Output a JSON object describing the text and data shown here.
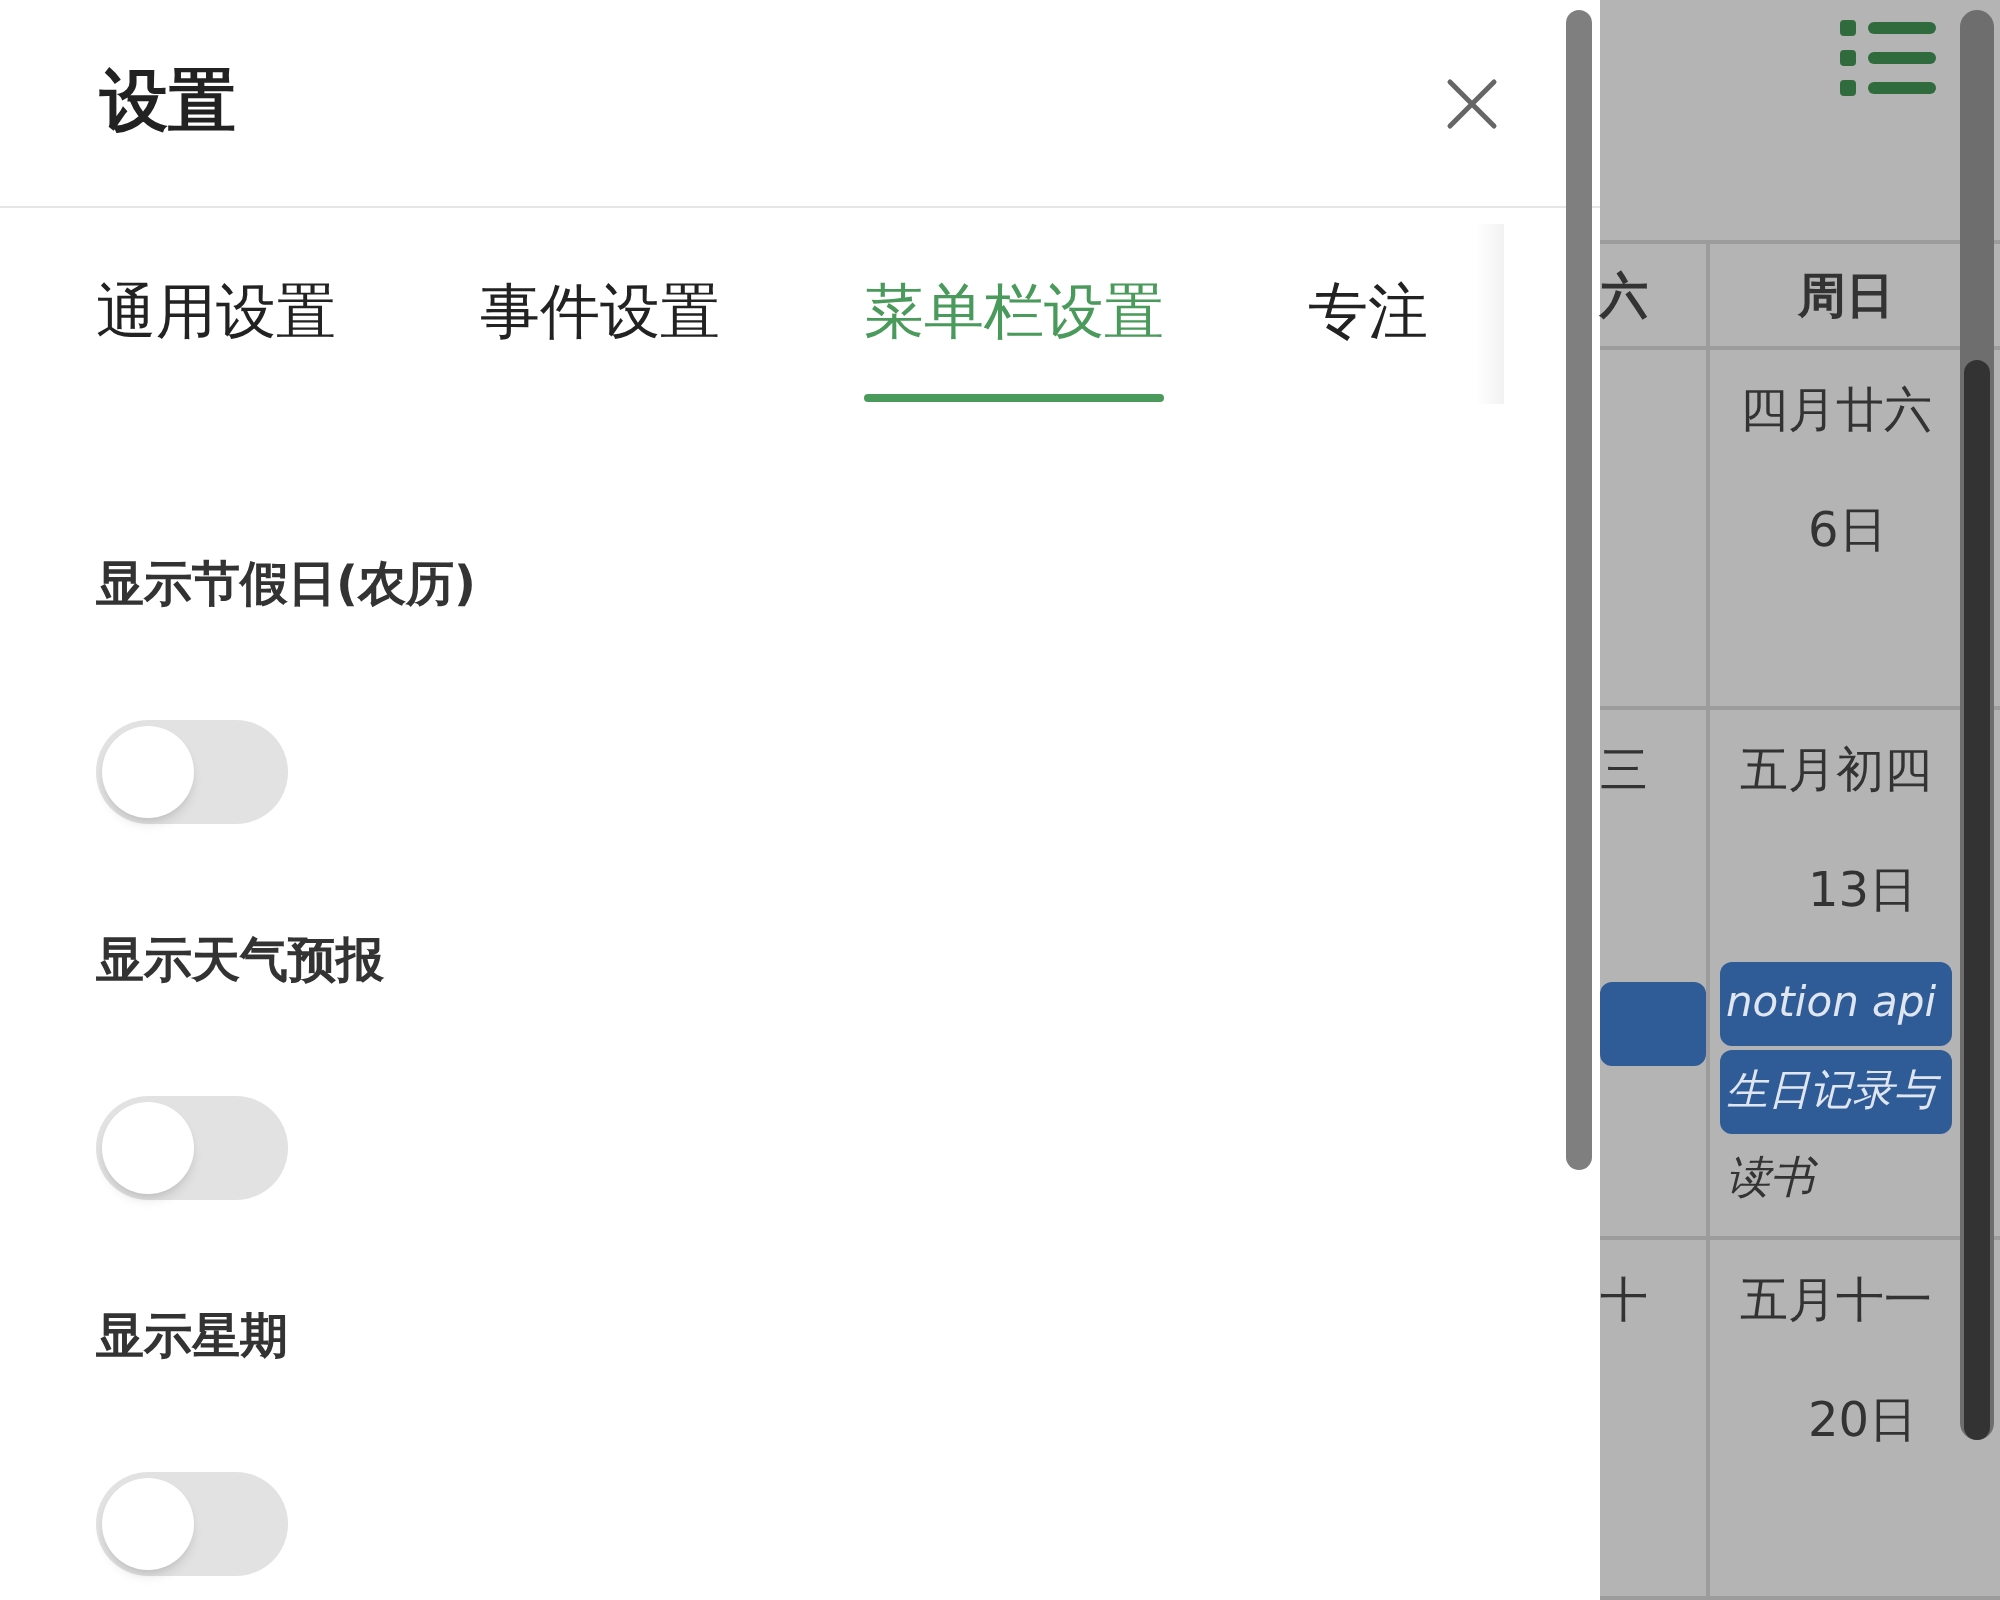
{
  "dialog": {
    "title": "设置",
    "tabs": [
      {
        "label": "通用设置",
        "selected": false
      },
      {
        "label": "事件设置",
        "selected": false
      },
      {
        "label": "菜单栏设置",
        "selected": true
      },
      {
        "label": "专注",
        "selected": false
      }
    ],
    "settings": [
      {
        "label": "显示节假日(农历)",
        "on": false
      },
      {
        "label": "显示天气预报",
        "on": false
      },
      {
        "label": "显示星期",
        "on": false
      }
    ]
  },
  "calendar": {
    "header": [
      "六",
      "周日"
    ],
    "rows": [
      {
        "partial": {},
        "sunday": {
          "lunar": "四月廿六",
          "day": "6日"
        }
      },
      {
        "partial": {
          "lunar": "三",
          "events": [
            {
              "kind": "block"
            }
          ]
        },
        "sunday": {
          "lunar": "五月初四",
          "day": "13日",
          "events": [
            {
              "kind": "block",
              "title": "notion api"
            },
            {
              "kind": "block",
              "title": "生日记录与"
            },
            {
              "kind": "plain",
              "title": "读书"
            }
          ]
        }
      },
      {
        "partial": {
          "lunar": "十"
        },
        "sunday": {
          "lunar": "五月十一",
          "day": "20日"
        }
      }
    ]
  }
}
